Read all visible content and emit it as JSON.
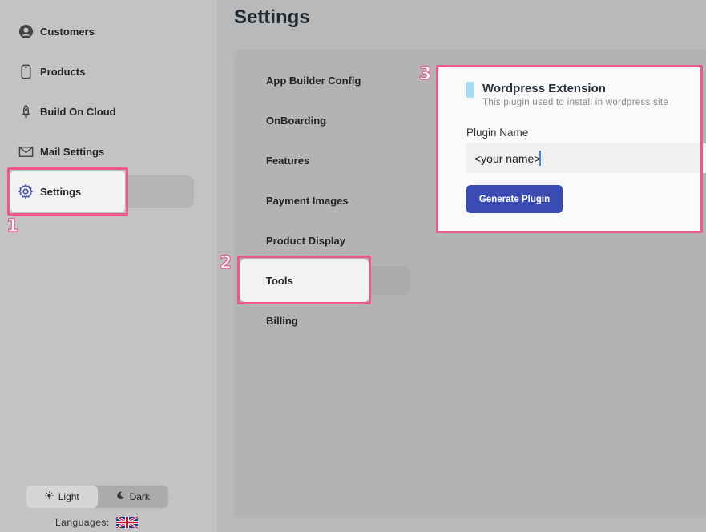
{
  "sidebar": {
    "items": [
      {
        "label": "Customers",
        "icon": "user-circle-icon"
      },
      {
        "label": "Products",
        "icon": "phone-icon"
      },
      {
        "label": "Build On Cloud",
        "icon": "rocket-icon"
      },
      {
        "label": "Mail Settings",
        "icon": "envelope-icon"
      },
      {
        "label": "Settings",
        "icon": "gear-icon",
        "active": true
      }
    ],
    "theme": {
      "light_label": "Light",
      "dark_label": "Dark",
      "active": "light"
    },
    "languages_label": "Languages:"
  },
  "page": {
    "title": "Settings"
  },
  "settings_menu": {
    "items": [
      {
        "label": "App Builder Config"
      },
      {
        "label": "OnBoarding"
      },
      {
        "label": "Features"
      },
      {
        "label": "Payment Images"
      },
      {
        "label": "Product Display"
      },
      {
        "label": "Tools",
        "active": true
      },
      {
        "label": "Billing"
      }
    ]
  },
  "plugin_card": {
    "title": "Wordpress Extension",
    "subtitle": "This plugin used to install in wordpress site",
    "field_label": "Plugin Name",
    "field_value": "<your name>",
    "button_label": "Generate Plugin"
  },
  "annotations": [
    "1",
    "2",
    "3"
  ],
  "colors": {
    "accent": "#3a4cb4",
    "annotation": "#ea5a8d",
    "card_accent": "#a4dcf2"
  }
}
